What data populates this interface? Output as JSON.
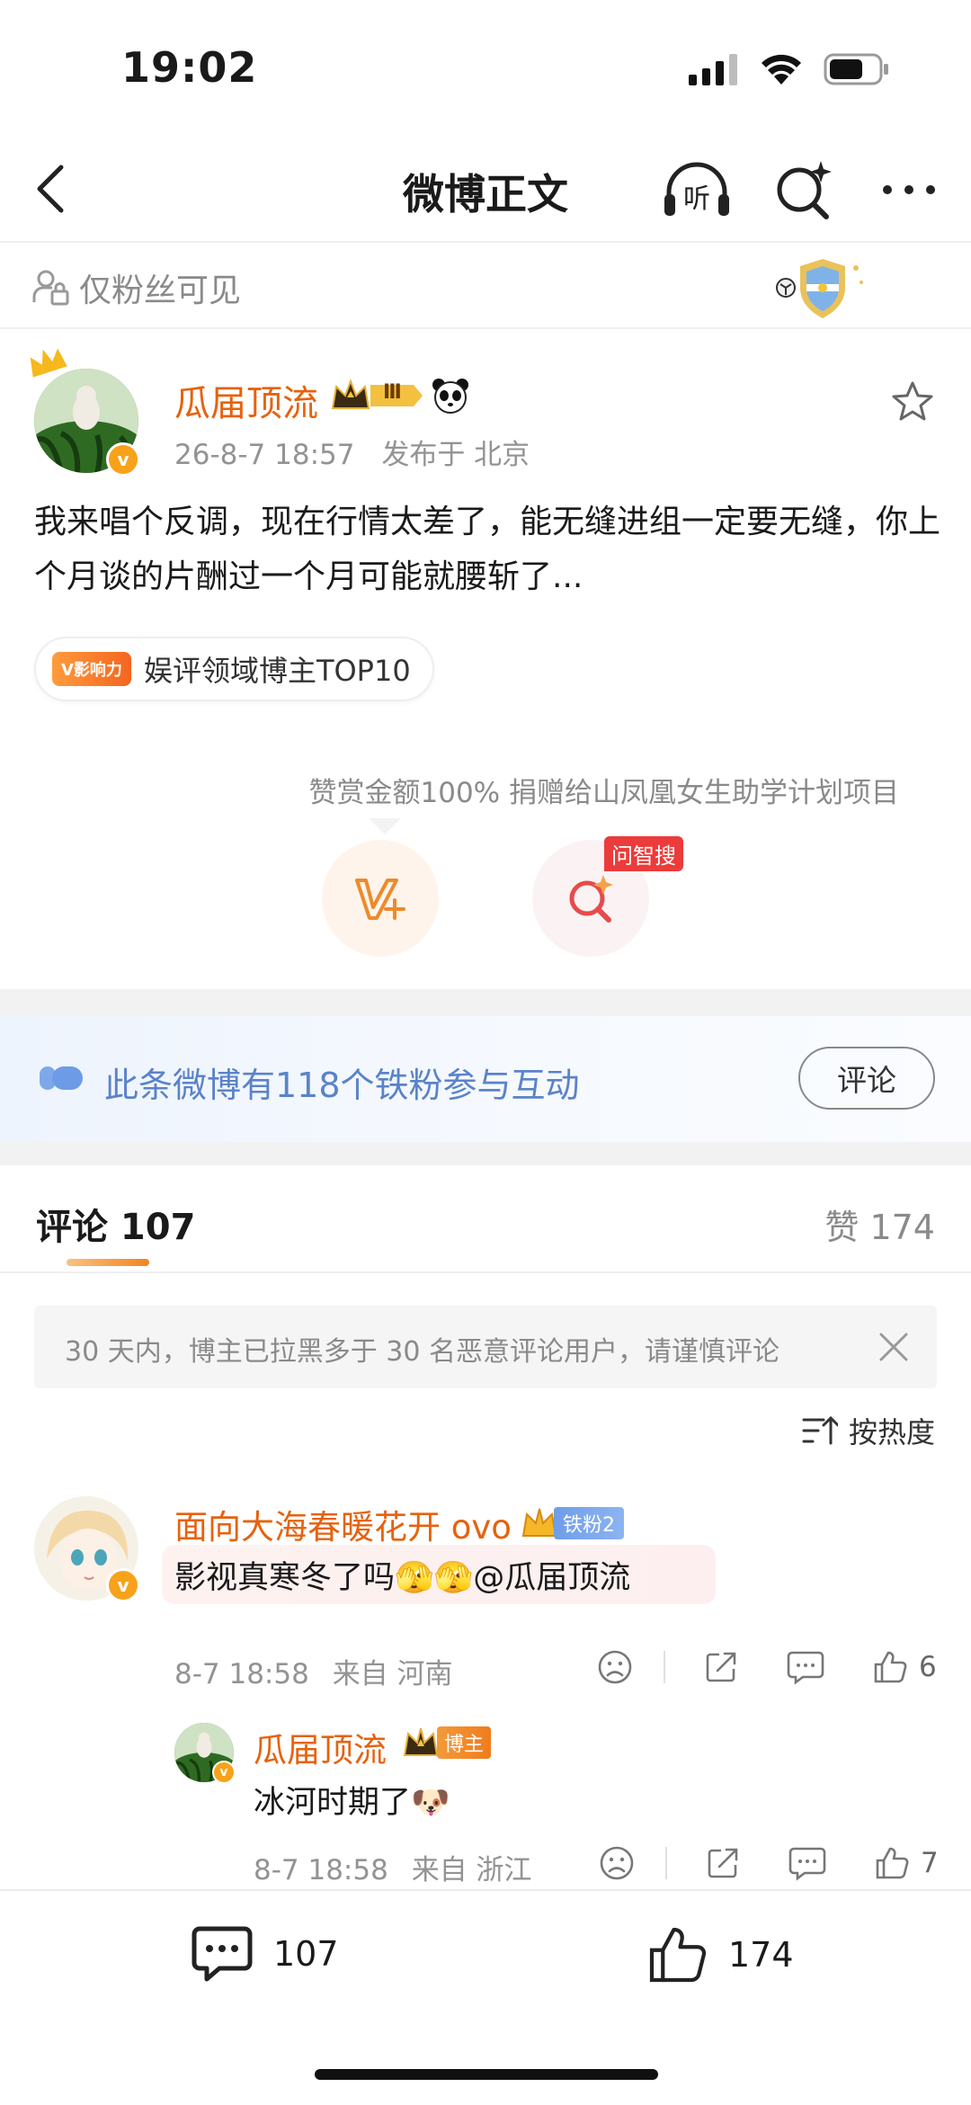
{
  "status_bar": {
    "time": "19:02"
  },
  "nav": {
    "title": "微博正文",
    "listen_label": "听"
  },
  "visibility": {
    "label": "仅粉丝可见"
  },
  "post": {
    "author": "瓜届顶流",
    "level_label": "Ⅲ",
    "date": "26-8-7 18:57",
    "location": "发布于 北京",
    "text": "我来唱个反调，现在行情太差了，能无缝进组一定要无缝，你上个月谈的片酬过一个月可能就腰斩了...",
    "influence_pill": "V影响力",
    "influence_tag": "娱评领域博主TOP10",
    "reward_note": "赞赏金额100% 捐赠给山凤凰女生助学计划项目",
    "ask_tag": "问智搜",
    "verified_mark": "v"
  },
  "iron_fans": {
    "text": "此条微博有118个铁粉参与互动",
    "comment_button": "评论"
  },
  "tabs": {
    "comments": "评论 107",
    "likes": "赞 174"
  },
  "notice": {
    "text": "30 天内，博主已拉黑多于 30 名恶意评论用户，请谨慎评论"
  },
  "sort": {
    "label": "按热度"
  },
  "comments": [
    {
      "name": "面向大海春暖花开 ovo",
      "fan_badge": "铁粉2",
      "text_prefix": "影视真寒冬了吗",
      "emoji": "🫣🫣",
      "mention": "@瓜届顶流",
      "date": "8-7 18:58",
      "location": "来自 河南",
      "likes": "6"
    }
  ],
  "reply": {
    "name": "瓜届顶流",
    "badge": "博主",
    "text": "冰河时期了",
    "emoji": "🐶",
    "date": "8-7 18:58",
    "location": "来自 浙江",
    "likes": "7"
  },
  "bottom_bar": {
    "comments": "107",
    "likes": "174"
  },
  "colors": {
    "accent": "#e6620e",
    "fans_blue": "#5a83c9",
    "ask_red": "#ec3b3b"
  }
}
